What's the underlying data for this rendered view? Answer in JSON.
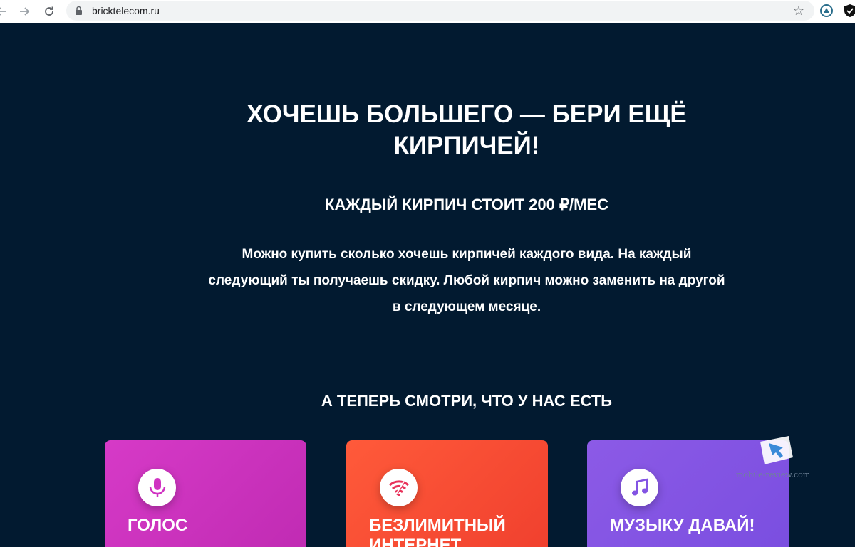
{
  "browser": {
    "url": "bricktelecom.ru",
    "icons": [
      "back-arrow-icon",
      "forward-arrow-icon",
      "reload-icon",
      "lock-icon",
      "bookmark-star-icon",
      "extension-icon",
      "shield-extension-icon"
    ]
  },
  "hero": {
    "title": "ХОЧЕШЬ БОЛЬШЕГО — БЕРИ ЕЩЁ КИРПИЧЕЙ!",
    "price": "КАЖДЫЙ КИРПИЧ СТОИТ 200 ₽/МЕС",
    "description": "Можно купить сколько хочешь кирпичей каждого вида. На каждый следующий ты получаешь скидку. Любой кирпич можно заменить на другой в следующем месяце."
  },
  "offers": {
    "heading": "А ТЕПЕРЬ СМОТРИ, ЧТО У НАС ЕСТЬ",
    "cards": [
      {
        "title": "ГОЛОС",
        "icon": "microphone-icon",
        "color": "#d032c2"
      },
      {
        "title": "БЕЗЛИМИТНЫЙ ИНТЕРНЕТ",
        "icon": "wifi-icon",
        "color": "#f64a33"
      },
      {
        "title": "МУЗЫКУ ДАВАЙ!",
        "icon": "music-note-icon",
        "color": "#8354e3"
      }
    ]
  },
  "watermark": {
    "text": "mobile-review.com"
  },
  "colors": {
    "background": "#021a30",
    "text": "#ffffff"
  }
}
